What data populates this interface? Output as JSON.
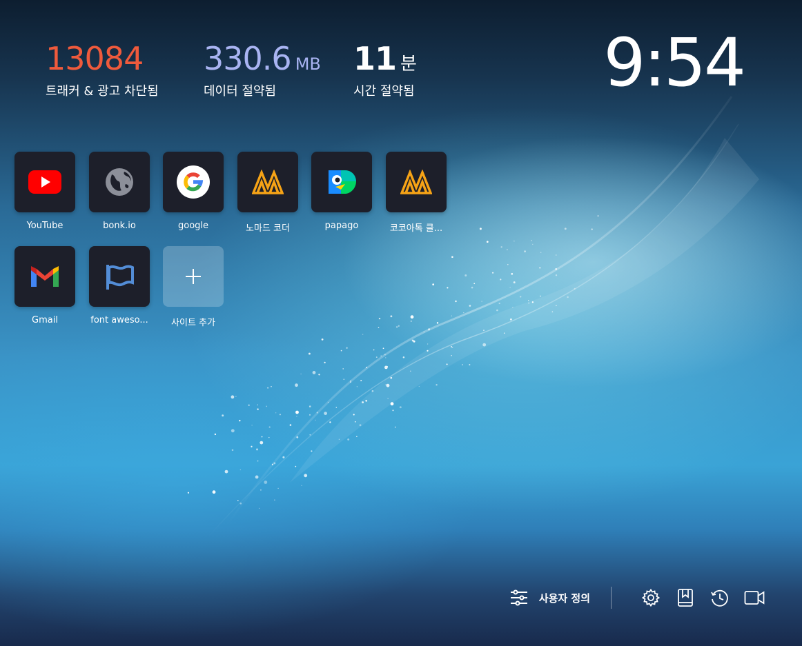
{
  "stats": {
    "trackers": {
      "value": "13084",
      "label": "트래커 & 광고 차단됨"
    },
    "data_saved": {
      "value": "330.6",
      "unit": "MB",
      "label": "데이터 절약됨"
    },
    "time_saved": {
      "value": "11",
      "unit": "분",
      "label": "시간 절약됨"
    }
  },
  "clock": {
    "time": "9:54"
  },
  "tiles": [
    {
      "name": "YouTube",
      "icon": "youtube-icon"
    },
    {
      "name": "bonk.io",
      "icon": "globe-icon"
    },
    {
      "name": "google",
      "icon": "google-icon"
    },
    {
      "name": "노마드 코더",
      "icon": "nomad-coder-icon"
    },
    {
      "name": "papago",
      "icon": "papago-icon"
    },
    {
      "name": "코코아톡 클...",
      "icon": "nomad-coder-icon"
    },
    {
      "name": "Gmail",
      "icon": "gmail-icon"
    },
    {
      "name": "font aweso...",
      "icon": "font-awesome-flag-icon"
    },
    {
      "name": "사이트 추가",
      "icon": "plus-icon"
    }
  ],
  "footer": {
    "customize_label": "사용자 정의",
    "icons": [
      "sliders-icon",
      "gear-icon",
      "bookmark-icon",
      "history-icon",
      "video-camera-icon"
    ]
  },
  "colors": {
    "trackers": "#ef5a3c",
    "data_saved": "#a9b4f2",
    "tile_bg": "#1d1f2a"
  }
}
